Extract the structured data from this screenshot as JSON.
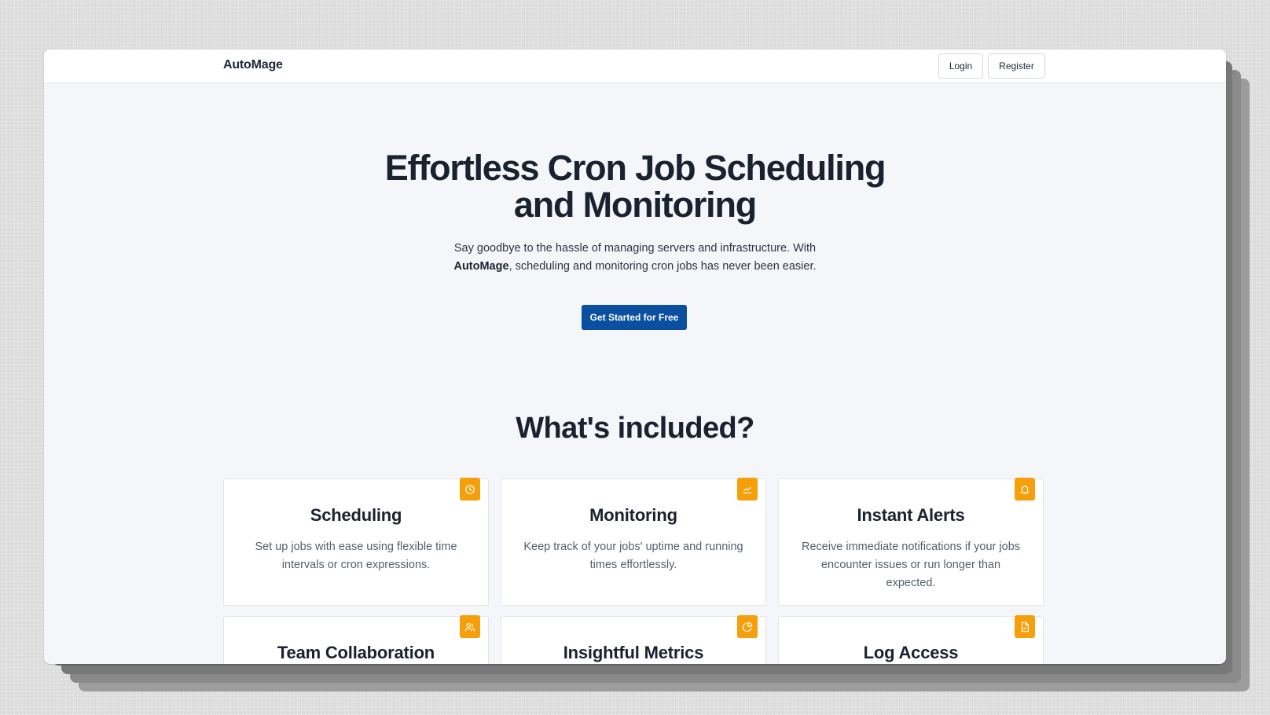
{
  "app": {
    "brand": "AutoMage"
  },
  "nav": {
    "login_label": "Login",
    "register_label": "Register"
  },
  "hero": {
    "title_line1": "Effortless Cron Job Scheduling",
    "title_line2": "and Monitoring",
    "subtitle_line1": "Say goodbye to the hassle of managing servers and infrastructure. With",
    "subtitle_brand": "AutoMage",
    "subtitle_line2_rest": ", scheduling and monitoring cron jobs has never been easier.",
    "cta_label": "Get Started for Free"
  },
  "features": {
    "heading": "What's included?",
    "cards": [
      {
        "title": "Scheduling",
        "description": "Set up jobs with ease using flexible time intervals or cron expressions.",
        "icon": "clock-icon"
      },
      {
        "title": "Monitoring",
        "description": "Keep track of your jobs' uptime and running times effortlessly.",
        "icon": "chart-line-icon"
      },
      {
        "title": "Instant Alerts",
        "description": "Receive immediate notifications if your jobs encounter issues or run longer than expected.",
        "icon": "bell-icon"
      },
      {
        "title": "Team Collaboration",
        "description": "",
        "icon": "users-icon"
      },
      {
        "title": "Insightful Metrics",
        "description": "",
        "icon": "pie-chart-icon"
      },
      {
        "title": "Log Access",
        "description": "",
        "icon": "file-icon"
      }
    ]
  },
  "colors": {
    "accent": "#0b50a0",
    "badge": "#f59f0a",
    "heading": "#1a2230",
    "background": "#f5f6f9"
  }
}
